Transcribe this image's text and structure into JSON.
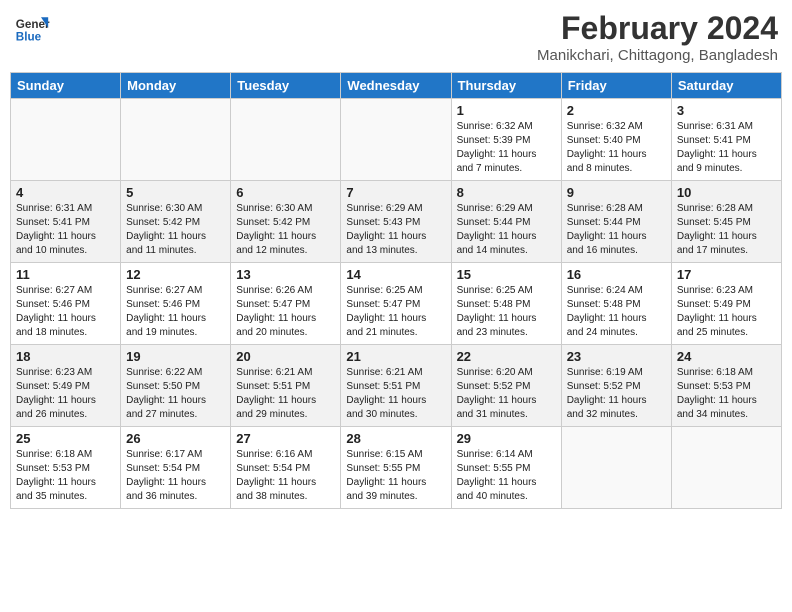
{
  "header": {
    "logo_general": "General",
    "logo_blue": "Blue",
    "title": "February 2024",
    "subtitle": "Manikchari, Chittagong, Bangladesh"
  },
  "days_of_week": [
    "Sunday",
    "Monday",
    "Tuesday",
    "Wednesday",
    "Thursday",
    "Friday",
    "Saturday"
  ],
  "weeks": [
    [
      {
        "day": "",
        "info": ""
      },
      {
        "day": "",
        "info": ""
      },
      {
        "day": "",
        "info": ""
      },
      {
        "day": "",
        "info": ""
      },
      {
        "day": "1",
        "info": "Sunrise: 6:32 AM\nSunset: 5:39 PM\nDaylight: 11 hours and 7 minutes."
      },
      {
        "day": "2",
        "info": "Sunrise: 6:32 AM\nSunset: 5:40 PM\nDaylight: 11 hours and 8 minutes."
      },
      {
        "day": "3",
        "info": "Sunrise: 6:31 AM\nSunset: 5:41 PM\nDaylight: 11 hours and 9 minutes."
      }
    ],
    [
      {
        "day": "4",
        "info": "Sunrise: 6:31 AM\nSunset: 5:41 PM\nDaylight: 11 hours and 10 minutes."
      },
      {
        "day": "5",
        "info": "Sunrise: 6:30 AM\nSunset: 5:42 PM\nDaylight: 11 hours and 11 minutes."
      },
      {
        "day": "6",
        "info": "Sunrise: 6:30 AM\nSunset: 5:42 PM\nDaylight: 11 hours and 12 minutes."
      },
      {
        "day": "7",
        "info": "Sunrise: 6:29 AM\nSunset: 5:43 PM\nDaylight: 11 hours and 13 minutes."
      },
      {
        "day": "8",
        "info": "Sunrise: 6:29 AM\nSunset: 5:44 PM\nDaylight: 11 hours and 14 minutes."
      },
      {
        "day": "9",
        "info": "Sunrise: 6:28 AM\nSunset: 5:44 PM\nDaylight: 11 hours and 16 minutes."
      },
      {
        "day": "10",
        "info": "Sunrise: 6:28 AM\nSunset: 5:45 PM\nDaylight: 11 hours and 17 minutes."
      }
    ],
    [
      {
        "day": "11",
        "info": "Sunrise: 6:27 AM\nSunset: 5:46 PM\nDaylight: 11 hours and 18 minutes."
      },
      {
        "day": "12",
        "info": "Sunrise: 6:27 AM\nSunset: 5:46 PM\nDaylight: 11 hours and 19 minutes."
      },
      {
        "day": "13",
        "info": "Sunrise: 6:26 AM\nSunset: 5:47 PM\nDaylight: 11 hours and 20 minutes."
      },
      {
        "day": "14",
        "info": "Sunrise: 6:25 AM\nSunset: 5:47 PM\nDaylight: 11 hours and 21 minutes."
      },
      {
        "day": "15",
        "info": "Sunrise: 6:25 AM\nSunset: 5:48 PM\nDaylight: 11 hours and 23 minutes."
      },
      {
        "day": "16",
        "info": "Sunrise: 6:24 AM\nSunset: 5:48 PM\nDaylight: 11 hours and 24 minutes."
      },
      {
        "day": "17",
        "info": "Sunrise: 6:23 AM\nSunset: 5:49 PM\nDaylight: 11 hours and 25 minutes."
      }
    ],
    [
      {
        "day": "18",
        "info": "Sunrise: 6:23 AM\nSunset: 5:49 PM\nDaylight: 11 hours and 26 minutes."
      },
      {
        "day": "19",
        "info": "Sunrise: 6:22 AM\nSunset: 5:50 PM\nDaylight: 11 hours and 27 minutes."
      },
      {
        "day": "20",
        "info": "Sunrise: 6:21 AM\nSunset: 5:51 PM\nDaylight: 11 hours and 29 minutes."
      },
      {
        "day": "21",
        "info": "Sunrise: 6:21 AM\nSunset: 5:51 PM\nDaylight: 11 hours and 30 minutes."
      },
      {
        "day": "22",
        "info": "Sunrise: 6:20 AM\nSunset: 5:52 PM\nDaylight: 11 hours and 31 minutes."
      },
      {
        "day": "23",
        "info": "Sunrise: 6:19 AM\nSunset: 5:52 PM\nDaylight: 11 hours and 32 minutes."
      },
      {
        "day": "24",
        "info": "Sunrise: 6:18 AM\nSunset: 5:53 PM\nDaylight: 11 hours and 34 minutes."
      }
    ],
    [
      {
        "day": "25",
        "info": "Sunrise: 6:18 AM\nSunset: 5:53 PM\nDaylight: 11 hours and 35 minutes."
      },
      {
        "day": "26",
        "info": "Sunrise: 6:17 AM\nSunset: 5:54 PM\nDaylight: 11 hours and 36 minutes."
      },
      {
        "day": "27",
        "info": "Sunrise: 6:16 AM\nSunset: 5:54 PM\nDaylight: 11 hours and 38 minutes."
      },
      {
        "day": "28",
        "info": "Sunrise: 6:15 AM\nSunset: 5:55 PM\nDaylight: 11 hours and 39 minutes."
      },
      {
        "day": "29",
        "info": "Sunrise: 6:14 AM\nSunset: 5:55 PM\nDaylight: 11 hours and 40 minutes."
      },
      {
        "day": "",
        "info": ""
      },
      {
        "day": "",
        "info": ""
      }
    ]
  ]
}
